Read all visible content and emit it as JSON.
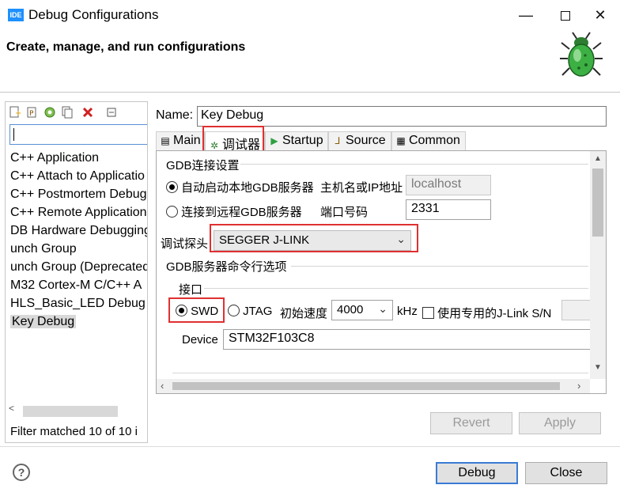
{
  "window": {
    "title": "Debug Configurations",
    "icon_text": "IDE",
    "min_glyph": "—",
    "close_glyph": "✕"
  },
  "header": {
    "title": "Create, manage, and run configurations"
  },
  "left_panel": {
    "toolbar_icons": [
      "new-config-icon",
      "new-prototype-icon",
      "export-icon",
      "duplicate-icon",
      "delete-icon",
      "collapse-all-icon"
    ],
    "filter_value": "",
    "items": [
      {
        "label": "C++ Application"
      },
      {
        "label": "C++ Attach to Applicatio"
      },
      {
        "label": "C++ Postmortem Debugg"
      },
      {
        "label": "C++ Remote Application"
      },
      {
        "label": "DB Hardware Debugging"
      },
      {
        "label": "unch Group"
      },
      {
        "label": "unch Group (Deprecated"
      },
      {
        "label": "M32 Cortex-M C/C++ A"
      },
      {
        "label": "HLS_Basic_LED Debug"
      },
      {
        "label": "Key Debug",
        "selected": true
      }
    ],
    "filter_status": "Filter matched 10 of 10 i"
  },
  "config": {
    "name_label": "Name:",
    "name_value": "Key Debug",
    "tabs": [
      {
        "label": "Main",
        "icon": "main-tab-icon"
      },
      {
        "label": "调试器",
        "icon": "debugger-tab-icon",
        "active": true
      },
      {
        "label": "Startup",
        "icon": "startup-tab-icon"
      },
      {
        "label": "Source",
        "icon": "source-tab-icon"
      },
      {
        "label": "Common",
        "icon": "common-tab-icon"
      }
    ],
    "gdb_group": {
      "title": "GDB连接设置",
      "radio_local_label": "自动启动本地GDB服务器",
      "radio_local_selected": true,
      "host_label": "主机名或IP地址",
      "host_value": "localhost",
      "radio_remote_label": "连接到远程GDB服务器",
      "radio_remote_selected": false,
      "port_label": "端口号码",
      "port_value": "2331"
    },
    "probe_label": "调试探头",
    "probe_value": "SEGGER J-LINK",
    "server_options_title": "GDB服务器命令行选项",
    "interface_group": {
      "title": "接口",
      "swd_label": "SWD",
      "swd_selected": true,
      "jtag_label": "JTAG",
      "jtag_selected": false,
      "speed_label": "初始速度",
      "speed_value": "4000",
      "speed_unit": "kHz",
      "jlink_sn_label": "使用专用的J-Link S/N",
      "jlink_sn_checked": false
    },
    "device_label": "Device",
    "device_value": "STM32F103C8",
    "revert_label": "Revert",
    "apply_label": "Apply"
  },
  "footer": {
    "help_glyph": "?",
    "debug_label": "Debug",
    "close_label": "Close"
  },
  "colors": {
    "highlight_box": "#e03030",
    "default_button_border": "#3a7bd5",
    "bug_green": "#3cb043"
  }
}
